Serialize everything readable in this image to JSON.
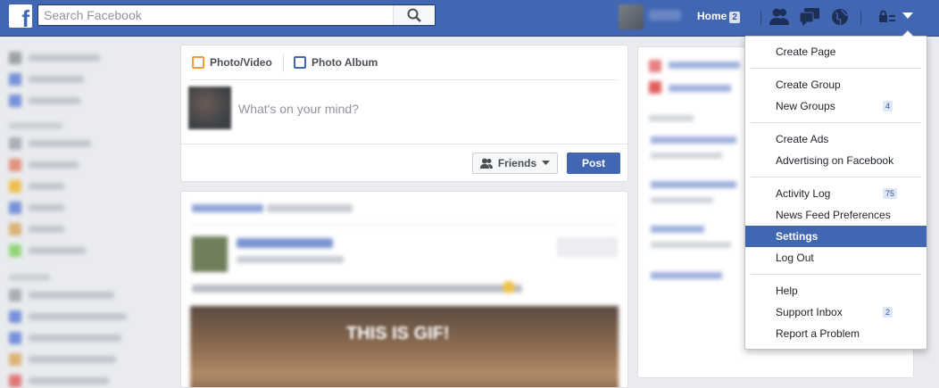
{
  "colors": {
    "brand": "#4267b2",
    "page_bg": "#e9ebee",
    "menu_active": "#4267b2"
  },
  "topbar": {
    "logo_letter": "f",
    "search_placeholder": "Search Facebook",
    "home_label": "Home",
    "home_count": "2",
    "icons": [
      "friend-requests-icon",
      "messages-icon",
      "notifications-globe-icon",
      "privacy-shortcuts-icon",
      "account-menu-chevron-icon"
    ]
  },
  "composer": {
    "tabs": [
      "Photo/Video",
      "Photo Album"
    ],
    "placeholder": "What's on your mind?",
    "audience_label": "Friends",
    "post_label": "Post"
  },
  "feed": {
    "caption": "THIS IS GIF!"
  },
  "menu": {
    "items": [
      {
        "label": "Create Page",
        "count": ""
      },
      {
        "label": "Create Group",
        "count": ""
      },
      {
        "label": "New Groups",
        "count": "4"
      },
      {
        "label": "Create Ads",
        "count": ""
      },
      {
        "label": "Advertising on Facebook",
        "count": ""
      },
      {
        "label": "Activity Log",
        "count": "75"
      },
      {
        "label": "News Feed Preferences",
        "count": ""
      },
      {
        "label": "Settings",
        "count": "",
        "active": true
      },
      {
        "label": "Log Out",
        "count": ""
      },
      {
        "label": "Help",
        "count": ""
      },
      {
        "label": "Support Inbox",
        "count": "2"
      },
      {
        "label": "Report a Problem",
        "count": ""
      }
    ]
  }
}
